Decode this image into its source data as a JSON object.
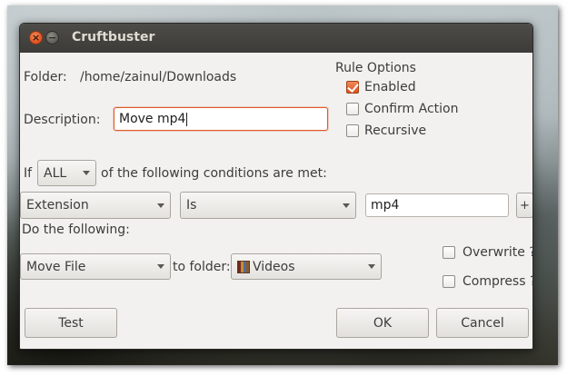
{
  "window": {
    "title": "Cruftbuster"
  },
  "folder": {
    "label": "Folder:",
    "path": "/home/zainul/Downloads"
  },
  "rule_options": {
    "heading": "Rule Options",
    "enabled": {
      "label": "Enabled",
      "checked": true
    },
    "confirm_action": {
      "label": "Confirm Action",
      "checked": false
    },
    "recursive": {
      "label": "Recursive",
      "checked": false
    }
  },
  "description": {
    "label": "Description:",
    "value": "Move mp4"
  },
  "conditions": {
    "prefix": "If",
    "match_mode": "ALL",
    "suffix": "of the following conditions are met:",
    "rows": [
      {
        "field": "Extension",
        "operator": "Is",
        "value": "mp4"
      }
    ],
    "add_label": "+"
  },
  "actions": {
    "heading": "Do the following:",
    "action": "Move File",
    "to_folder_label": "to folder:",
    "folder": "Videos",
    "folder_icon": "folder-icon",
    "overwrite": {
      "label": "Overwrite ?",
      "checked": false
    },
    "compress": {
      "label": "Compress ?",
      "checked": false
    }
  },
  "buttons": {
    "test": "Test",
    "ok": "OK",
    "cancel": "Cancel"
  },
  "colors": {
    "accent": "#e05a2a",
    "titlebar": "#3c3b37",
    "window_bg": "#f2f1f0"
  }
}
